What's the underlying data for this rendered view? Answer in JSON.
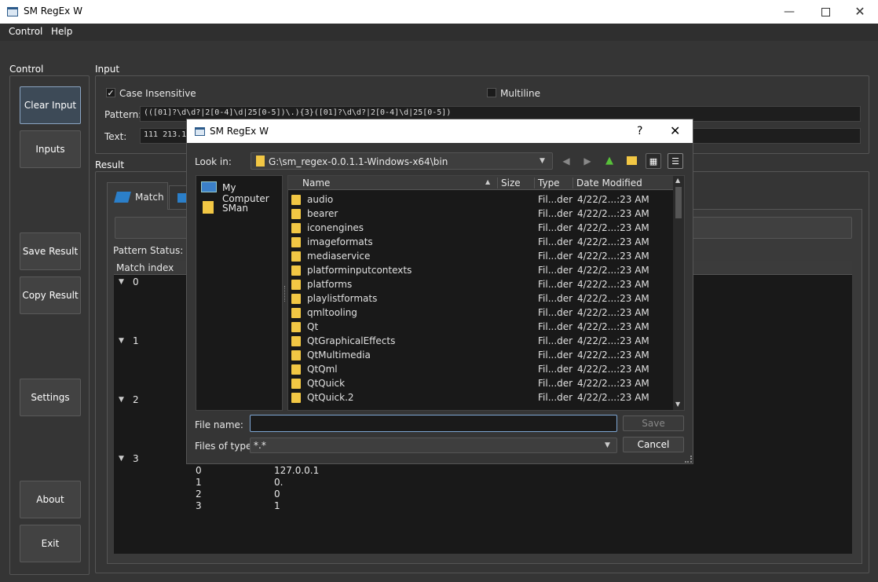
{
  "app": {
    "title": "SM RegEx W",
    "menu": [
      "Control",
      "Help"
    ]
  },
  "control": {
    "label": "Control",
    "buttons": {
      "clear_input": "Clear Input",
      "inputs": "Inputs",
      "save_result": "Save Result",
      "copy_result": "Copy Result",
      "settings": "Settings",
      "about": "About",
      "exit": "Exit"
    }
  },
  "input": {
    "label": "Input",
    "case_insensitive": {
      "label": "Case Insensitive",
      "checked": true
    },
    "multiline": {
      "label": "Multiline",
      "checked": false
    },
    "pattern_label": "Pattern:",
    "pattern_value": "(([01]?\\d\\d?|2[0-4]\\d|25[0-5])\\.){3}([01]?\\d\\d?|2[0-4]\\d|25[0-5])",
    "text_label": "Text:",
    "text_value": "111 213.13"
  },
  "result": {
    "label": "Result",
    "tab_match": "Match",
    "pattern_status": "Pattern Status: Val",
    "match_index_header": "Match index",
    "tree": [
      "0",
      "1",
      "2",
      "3"
    ],
    "rows": [
      {
        "index": "0",
        "value": "127.0.0.1"
      },
      {
        "index": "1",
        "value": "0."
      },
      {
        "index": "2",
        "value": "0"
      },
      {
        "index": "3",
        "value": "1"
      }
    ]
  },
  "dialog": {
    "title": "SM RegEx W",
    "help": "?",
    "look_in_label": "Look in:",
    "look_in_value": "G:\\sm_regex-0.0.1.1-Windows-x64\\bin",
    "places": [
      "My Computer",
      "SMan"
    ],
    "columns": {
      "name": "Name",
      "size": "Size",
      "type": "Type",
      "date": "Date Modified"
    },
    "files": [
      {
        "name": "audio",
        "type": "Fil...der",
        "date": "4/22/2...:23 AM"
      },
      {
        "name": "bearer",
        "type": "Fil...der",
        "date": "4/22/2...:23 AM"
      },
      {
        "name": "iconengines",
        "type": "Fil...der",
        "date": "4/22/2...:23 AM"
      },
      {
        "name": "imageformats",
        "type": "Fil...der",
        "date": "4/22/2...:23 AM"
      },
      {
        "name": "mediaservice",
        "type": "Fil...der",
        "date": "4/22/2...:23 AM"
      },
      {
        "name": "platforminputcontexts",
        "type": "Fil...der",
        "date": "4/22/2...:23 AM"
      },
      {
        "name": "platforms",
        "type": "Fil...der",
        "date": "4/22/2...:23 AM"
      },
      {
        "name": "playlistformats",
        "type": "Fil...der",
        "date": "4/22/2...:23 AM"
      },
      {
        "name": "qmltooling",
        "type": "Fil...der",
        "date": "4/22/2...:23 AM"
      },
      {
        "name": "Qt",
        "type": "Fil...der",
        "date": "4/22/2...:23 AM"
      },
      {
        "name": "QtGraphicalEffects",
        "type": "Fil...der",
        "date": "4/22/2...:23 AM"
      },
      {
        "name": "QtMultimedia",
        "type": "Fil...der",
        "date": "4/22/2...:23 AM"
      },
      {
        "name": "QtQml",
        "type": "Fil...der",
        "date": "4/22/2...:23 AM"
      },
      {
        "name": "QtQuick",
        "type": "Fil...der",
        "date": "4/22/2...:23 AM"
      },
      {
        "name": "QtQuick.2",
        "type": "Fil...der",
        "date": "4/22/2...:23 AM"
      }
    ],
    "file_name_label": "File name:",
    "file_name_value": "",
    "files_of_type_label": "Files of type:",
    "files_of_type_value": "*.*",
    "save": "Save",
    "cancel": "Cancel"
  }
}
